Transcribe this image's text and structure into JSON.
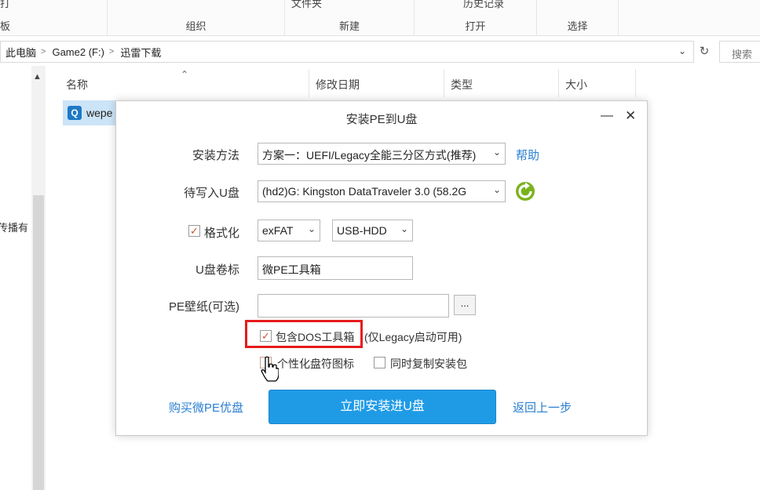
{
  "ribbon": {
    "top_partial": [
      "打",
      "文件夹",
      "历史记录"
    ],
    "groups": [
      "板",
      "组织",
      "新建",
      "打开",
      "选择"
    ]
  },
  "address": {
    "crumbs": [
      "此电脑",
      "Game2 (F:)",
      "迅雷下载"
    ],
    "search_placeholder": "搜索"
  },
  "nav": {
    "partial_text": "传播有"
  },
  "columns": [
    "名称",
    "修改日期",
    "类型",
    "大小"
  ],
  "file": {
    "name": "wepe"
  },
  "dialog": {
    "title": "安装PE到U盘",
    "install_method_label": "安装方法",
    "install_method_value": "方案一：UEFI/Legacy全能三分区方式(推荐)",
    "help_link": "帮助",
    "target_label": "待写入U盘",
    "target_value": "(hd2)G: Kingston DataTraveler 3.0 (58.2G",
    "format_label": "格式化",
    "format_checked": true,
    "fs_value": "exFAT",
    "mode_value": "USB-HDD",
    "volume_label": "U盘卷标",
    "volume_value": "微PE工具箱",
    "wallpaper_label": "PE壁纸(可选)",
    "wallpaper_value": "",
    "browse_label": "...",
    "dos_label": "包含DOS工具箱",
    "dos_note": "(仅Legacy启动可用)",
    "dos_checked": true,
    "icon_label": "个性化盘符图标",
    "copy_label": "同时复制安装包",
    "buy_link": "购买微PE优盘",
    "install_button": "立即安装进U盘",
    "back_link": "返回上一步"
  },
  "colors": {
    "accent": "#1f9be6",
    "link": "#2a7fd0",
    "highlight": "#e61b1b",
    "check": "#d0502c"
  }
}
